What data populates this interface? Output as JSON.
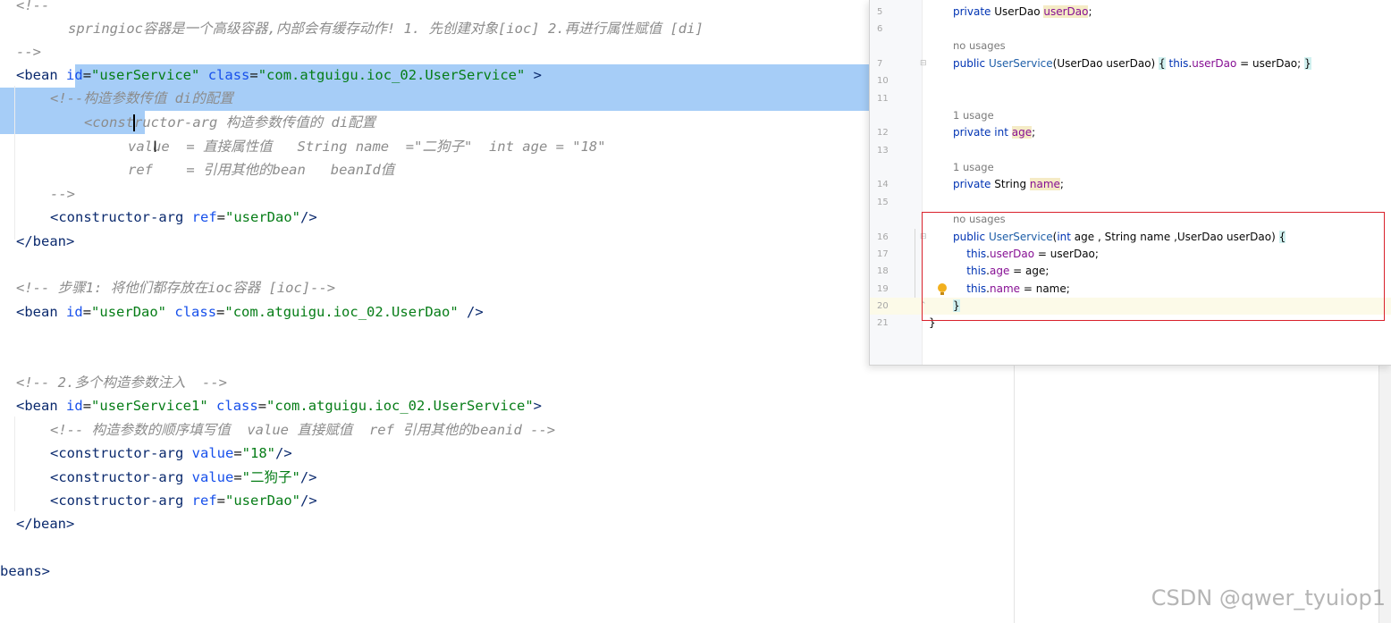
{
  "xml_editor": {
    "lines": [
      {
        "text": "<!--",
        "kind": "comment"
      },
      {
        "text": "   springioc容器是一个高级容器,内部会有缓存动作! 1. 先创建对象[ioc] 2.再进行属性赋值 [di]",
        "kind": "comment"
      },
      {
        "text": "-->",
        "kind": "comment"
      },
      {
        "kind": "bean",
        "tag": "bean",
        "attrs": [
          {
            "name": "id",
            "value": "\"userService\""
          },
          {
            "name": "class",
            "value": "\"com.atguigu.ioc_02.UserService\""
          }
        ],
        "end": " >"
      },
      {
        "text": "<!--构造参数传值 di的配置",
        "kind": "comment"
      },
      {
        "text": "<constructor-arg 构造参数传值的 di配置",
        "kind": "comment"
      },
      {
        "text": "value  = 直接属性值   String name  =\"二狗子\"  int age = \"18\"",
        "kind": "comment"
      },
      {
        "text": "ref    = 引用其他的bean   beanId值",
        "kind": "comment"
      },
      {
        "text": "-->",
        "kind": "comment"
      },
      {
        "kind": "tag",
        "tag": "constructor-arg",
        "attrs": [
          {
            "name": "ref",
            "value": "\"userDao\""
          }
        ],
        "end": "/>"
      },
      {
        "kind": "close",
        "tag": "bean"
      },
      {
        "text": "",
        "kind": "blank"
      },
      {
        "text": "<!-- 步骤1: 将他们都存放在ioc容器 [ioc]-->",
        "kind": "comment"
      },
      {
        "kind": "tag",
        "tag": "bean",
        "attrs": [
          {
            "name": "id",
            "value": "\"userDao\""
          },
          {
            "name": "class",
            "value": "\"com.atguigu.ioc_02.UserDao\""
          }
        ],
        "end": " />"
      },
      {
        "text": "",
        "kind": "blank"
      },
      {
        "text": "",
        "kind": "blank"
      },
      {
        "text": "<!-- 2.多个构造参数注入  -->",
        "kind": "comment"
      },
      {
        "kind": "tag",
        "tag": "bean",
        "attrs": [
          {
            "name": "id",
            "value": "\"userService1\""
          },
          {
            "name": "class",
            "value": "\"com.atguigu.ioc_02.UserService\""
          }
        ],
        "end": ">"
      },
      {
        "text": "<!-- 构造参数的顺序填写值  value 直接赋值  ref 引用其他的beanid -->",
        "kind": "comment"
      },
      {
        "kind": "tag",
        "tag": "constructor-arg",
        "attrs": [
          {
            "name": "value",
            "value": "\"18\""
          }
        ],
        "end": "/>"
      },
      {
        "kind": "tag",
        "tag": "constructor-arg",
        "attrs": [
          {
            "name": "value",
            "value": "\"二狗子\""
          }
        ],
        "end": "/>"
      },
      {
        "kind": "tag",
        "tag": "constructor-arg",
        "attrs": [
          {
            "name": "ref",
            "value": "\"userDao\""
          }
        ],
        "end": "/>"
      },
      {
        "kind": "close",
        "tag": "bean"
      },
      {
        "text": "",
        "kind": "blank"
      },
      {
        "text": "beans>",
        "kind": "fragment"
      }
    ]
  },
  "java_popup": {
    "lines": [
      {
        "num": "5",
        "code": [
          {
            "t": "private",
            "c": "kw"
          },
          {
            "t": " UserDao "
          },
          {
            "t": "userDao",
            "c": "fld hl"
          },
          {
            "t": ";"
          }
        ]
      },
      {
        "num": "6",
        "code": []
      },
      {
        "hint": "no usages"
      },
      {
        "num": "7",
        "code": [
          {
            "t": "public",
            "c": "kw"
          },
          {
            "t": " "
          },
          {
            "t": "UserService",
            "c": "meth"
          },
          {
            "t": "(UserDao userDao) "
          },
          {
            "t": "{",
            "c": "brace-hl"
          },
          {
            "t": " "
          },
          {
            "t": "this",
            "c": "kw"
          },
          {
            "t": "."
          },
          {
            "t": "userDao",
            "c": "fld"
          },
          {
            "t": " = userDao; "
          },
          {
            "t": "}",
            "c": "brace-hl"
          }
        ]
      },
      {
        "num": "10",
        "code": []
      },
      {
        "num": "11",
        "code": []
      },
      {
        "hint": "1 usage"
      },
      {
        "num": "12",
        "code": [
          {
            "t": "private",
            "c": "kw"
          },
          {
            "t": " "
          },
          {
            "t": "int",
            "c": "kw"
          },
          {
            "t": " "
          },
          {
            "t": "age",
            "c": "fld hl"
          },
          {
            "t": ";"
          }
        ]
      },
      {
        "num": "13",
        "code": []
      },
      {
        "hint": "1 usage"
      },
      {
        "num": "14",
        "code": [
          {
            "t": "private",
            "c": "kw"
          },
          {
            "t": " String "
          },
          {
            "t": "name",
            "c": "fld hl"
          },
          {
            "t": ";"
          }
        ]
      },
      {
        "num": "15",
        "code": []
      },
      {
        "hint": "no usages"
      },
      {
        "num": "16",
        "code": [
          {
            "t": "public",
            "c": "kw"
          },
          {
            "t": " "
          },
          {
            "t": "UserService",
            "c": "meth"
          },
          {
            "t": "("
          },
          {
            "t": "int",
            "c": "kw"
          },
          {
            "t": " age , String name ,UserDao userDao) "
          },
          {
            "t": "{",
            "c": "brace-hl"
          }
        ]
      },
      {
        "num": "17",
        "code": [
          {
            "t": "    "
          },
          {
            "t": "this",
            "c": "kw"
          },
          {
            "t": "."
          },
          {
            "t": "userDao",
            "c": "fld"
          },
          {
            "t": " = userDao;"
          }
        ]
      },
      {
        "num": "18",
        "code": [
          {
            "t": "    "
          },
          {
            "t": "this",
            "c": "kw"
          },
          {
            "t": "."
          },
          {
            "t": "age",
            "c": "fld"
          },
          {
            "t": " = age;"
          }
        ]
      },
      {
        "num": "19",
        "code": [
          {
            "t": "    "
          },
          {
            "t": "this",
            "c": "kw"
          },
          {
            "t": "."
          },
          {
            "t": "name",
            "c": "fld"
          },
          {
            "t": " = name;"
          }
        ],
        "bulb": true
      },
      {
        "num": "20",
        "code": [
          {
            "t": "}",
            "c": "brace-hl"
          }
        ],
        "current": true
      },
      {
        "num": "21",
        "code": [
          {
            "t": "}"
          }
        ],
        "outer": true
      }
    ]
  },
  "watermark": "CSDN @qwer_tyuiop1"
}
